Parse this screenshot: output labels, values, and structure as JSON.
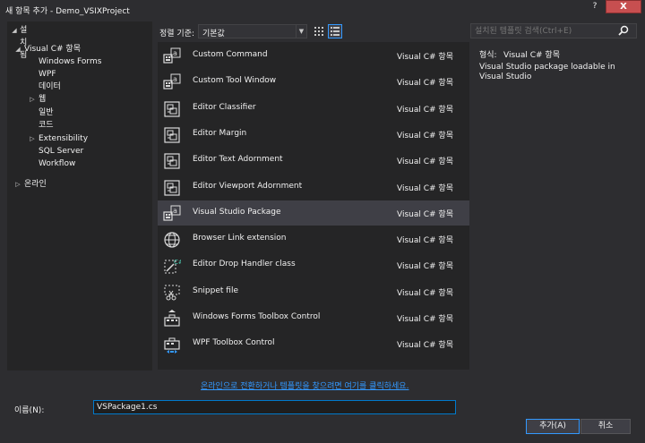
{
  "window": {
    "title": "새 항목 추가 - Demo_VSIXProject",
    "help_label": "?",
    "close_label": "X"
  },
  "sidebar": {
    "header": "설치됨",
    "tree": [
      {
        "label": "Visual C# 항목",
        "level": 0,
        "expand": "open"
      },
      {
        "label": "Windows Forms",
        "level": 1,
        "expand": "none"
      },
      {
        "label": "WPF",
        "level": 1,
        "expand": "none"
      },
      {
        "label": "데이터",
        "level": 1,
        "expand": "none"
      },
      {
        "label": "웹",
        "level": 1,
        "expand": "closed"
      },
      {
        "label": "일반",
        "level": 1,
        "expand": "none"
      },
      {
        "label": "코드",
        "level": 1,
        "expand": "none"
      },
      {
        "label": "Extensibility",
        "level": 1,
        "expand": "closed"
      },
      {
        "label": "SQL Server",
        "level": 1,
        "expand": "none"
      },
      {
        "label": "Workflow",
        "level": 1,
        "expand": "none"
      },
      {
        "label": "온라인",
        "level": 0,
        "expand": "closed"
      }
    ]
  },
  "toolbar": {
    "sort_label": "정렬 기준:",
    "sort_value": "기본값"
  },
  "search": {
    "placeholder": "설치된 템플릿 검색(Ctrl+E)"
  },
  "templates": [
    {
      "name": "Custom Command",
      "lang": "Visual C# 항목",
      "icon": "command-template-icon"
    },
    {
      "name": "Custom Tool Window",
      "lang": "Visual C# 항목",
      "icon": "tool-window-template-icon"
    },
    {
      "name": "Editor Classifier",
      "lang": "Visual C# 항목",
      "icon": "editor-template-icon"
    },
    {
      "name": "Editor Margin",
      "lang": "Visual C# 항목",
      "icon": "editor-template-icon"
    },
    {
      "name": "Editor Text Adornment",
      "lang": "Visual C# 항목",
      "icon": "editor-template-icon"
    },
    {
      "name": "Editor Viewport Adornment",
      "lang": "Visual C# 항목",
      "icon": "editor-template-icon"
    },
    {
      "name": "Visual Studio Package",
      "lang": "Visual C# 항목",
      "icon": "package-template-icon",
      "selected": true
    },
    {
      "name": "Browser Link extension",
      "lang": "Visual C# 항목",
      "icon": "globe-icon"
    },
    {
      "name": "Editor Drop Handler class",
      "lang": "Visual C# 항목",
      "icon": "drop-handler-icon"
    },
    {
      "name": "Snippet file",
      "lang": "Visual C# 항목",
      "icon": "snippet-icon"
    },
    {
      "name": "Windows Forms Toolbox Control",
      "lang": "Visual C# 항목",
      "icon": "toolbox-control-icon"
    },
    {
      "name": "WPF Toolbox Control",
      "lang": "Visual C# 항목",
      "icon": "wpf-toolbox-icon"
    }
  ],
  "details": {
    "type_label": "형식:",
    "type_value": "Visual C# 항목",
    "description": "Visual Studio package loadable in Visual Studio"
  },
  "online_link": "온라인으로 전환하거나 템플릿을 찾으려면 여기를 클릭하세요.",
  "footer": {
    "name_label": "이름(N):",
    "name_value": "VSPackage1.cs",
    "add_label": "추가(A)",
    "cancel_label": "취소"
  },
  "colors": {
    "accent": "#007acc",
    "link": "#3399ff",
    "close": "#c74f50",
    "selection": "#3f3f46"
  }
}
